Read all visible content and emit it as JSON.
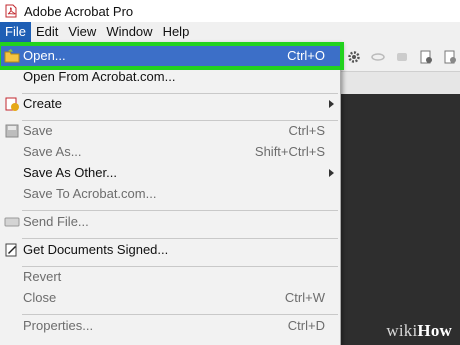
{
  "window": {
    "title": "Adobe Acrobat Pro",
    "icon": "acrobat-pdf-icon"
  },
  "menubar": {
    "items": [
      {
        "label": "File",
        "active": true
      },
      {
        "label": "Edit",
        "active": false
      },
      {
        "label": "View",
        "active": false
      },
      {
        "label": "Window",
        "active": false
      },
      {
        "label": "Help",
        "active": false
      }
    ]
  },
  "file_menu": {
    "items": [
      {
        "label": "Open...",
        "shortcut": "Ctrl+O",
        "enabled": true,
        "highlighted": true,
        "icon": "open-folder-icon"
      },
      {
        "label": "Open From Acrobat.com...",
        "shortcut": "",
        "enabled": true
      },
      {
        "label": "Create",
        "shortcut": "",
        "enabled": true,
        "submenu": true,
        "icon": "create-pdf-icon"
      },
      {
        "label": "Save",
        "shortcut": "Ctrl+S",
        "enabled": false,
        "icon": "save-disk-icon"
      },
      {
        "label": "Save As...",
        "shortcut": "Shift+Ctrl+S",
        "enabled": false
      },
      {
        "label": "Save As Other...",
        "shortcut": "",
        "enabled": true,
        "submenu": true
      },
      {
        "label": "Save To Acrobat.com...",
        "shortcut": "",
        "enabled": false
      },
      {
        "label": "Send File...",
        "shortcut": "",
        "enabled": false,
        "icon": "send-file-icon"
      },
      {
        "label": "Get Documents Signed...",
        "shortcut": "",
        "enabled": true,
        "icon": "sign-document-icon"
      },
      {
        "label": "Revert",
        "shortcut": "",
        "enabled": false
      },
      {
        "label": "Close",
        "shortcut": "Ctrl+W",
        "enabled": false
      },
      {
        "label": "Properties...",
        "shortcut": "Ctrl+D",
        "enabled": false
      }
    ]
  },
  "colors": {
    "menu_highlight": "#3c6fc8",
    "highlight_outline": "#22d21e",
    "active_menu": "#1e5fb5"
  },
  "watermark": {
    "part1": "wiki",
    "part2": "How"
  }
}
